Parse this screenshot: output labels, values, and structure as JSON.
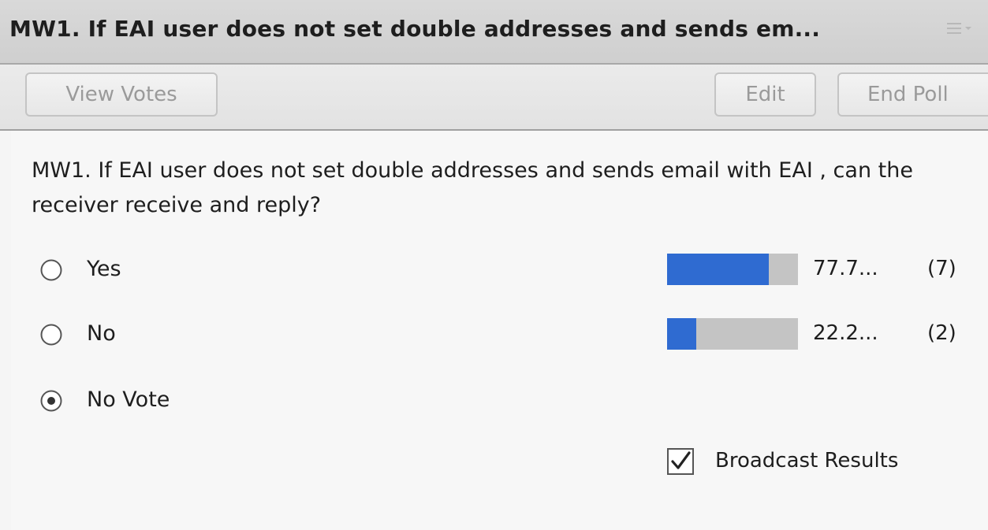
{
  "pod": {
    "title": "MW1. If EAI user does not set double addresses and sends em...",
    "menu_icon": "pod-options-menu-icon"
  },
  "toolbar": {
    "view_votes_label": "View Votes",
    "edit_label": "Edit",
    "end_poll_label": "End Poll"
  },
  "question": {
    "text": "MW1. If EAI user does not set double addresses and sends email with EAI , can the receiver receive and reply?"
  },
  "answers": [
    {
      "label": "Yes",
      "selected": false,
      "percent_text": "77.7...",
      "count_text": "(7)",
      "fraction": 0.777
    },
    {
      "label": "No",
      "selected": false,
      "percent_text": "22.2...",
      "count_text": "(2)",
      "fraction": 0.222
    },
    {
      "label": "No Vote",
      "selected": true
    }
  ],
  "broadcast": {
    "label": "Broadcast Results",
    "checked": true
  },
  "colors": {
    "bar_fill": "#2f6bd1",
    "bar_track": "#c4c4c4"
  }
}
